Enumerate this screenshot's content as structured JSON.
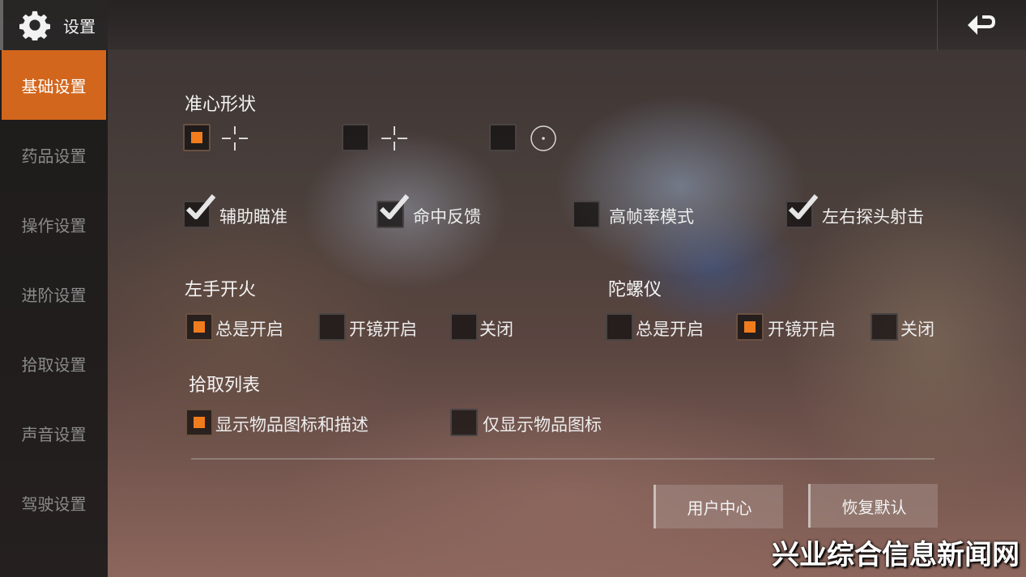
{
  "header": {
    "title": "设置"
  },
  "sidebar": {
    "items": [
      {
        "label": "基础设置",
        "active": true
      },
      {
        "label": "药品设置"
      },
      {
        "label": "操作设置"
      },
      {
        "label": "进阶设置"
      },
      {
        "label": "拾取设置"
      },
      {
        "label": "声音设置"
      },
      {
        "label": "驾驶设置"
      }
    ]
  },
  "crosshair": {
    "title": "准心形状",
    "options": [
      {
        "icon": "crosshair-gap-icon",
        "selected": true
      },
      {
        "icon": "crosshair-small-icon",
        "selected": false
      },
      {
        "icon": "crosshair-circle-icon",
        "selected": false
      }
    ]
  },
  "toggles": [
    {
      "label": "辅助瞄准",
      "checked": true
    },
    {
      "label": "命中反馈",
      "checked": true
    },
    {
      "label": "高帧率模式",
      "checked": false
    },
    {
      "label": "左右探头射击",
      "checked": true
    }
  ],
  "left_fire": {
    "title": "左手开火",
    "options": [
      {
        "label": "总是开启",
        "selected": true
      },
      {
        "label": "开镜开启",
        "selected": false
      },
      {
        "label": "关闭",
        "selected": false
      }
    ]
  },
  "gyro": {
    "title": "陀螺仪",
    "options": [
      {
        "label": "总是开启",
        "selected": false
      },
      {
        "label": "开镜开启",
        "selected": true
      },
      {
        "label": "关闭",
        "selected": false
      }
    ]
  },
  "pickup_list": {
    "title": "拾取列表",
    "options": [
      {
        "label": "显示物品图标和描述",
        "selected": true
      },
      {
        "label": "仅显示物品图标",
        "selected": false
      }
    ]
  },
  "buttons": {
    "user_center": "用户中心",
    "restore_default": "恢复默认"
  },
  "watermark": "兴业综合信息新闻网",
  "colors": {
    "accent": "#d2661c",
    "selected_dot": "#f07c1e",
    "sidebar_bg": "#1c1a1a"
  }
}
